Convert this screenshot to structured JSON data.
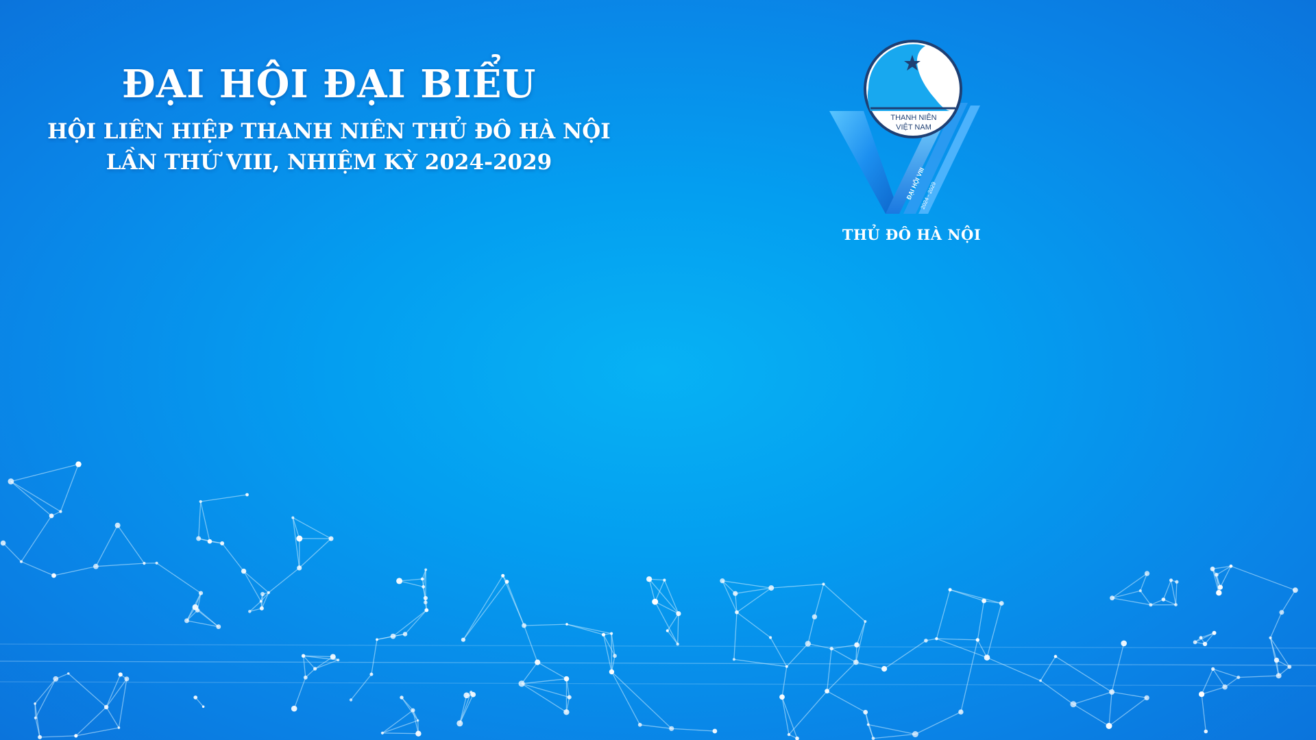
{
  "heading": {
    "title": "ĐẠI HỘI ĐẠI BIỂU",
    "subtitle_line1": "HỘI LIÊN HIỆP THANH NIÊN THỦ ĐÔ HÀ NỘI",
    "subtitle_line2": "LẦN THỨ VIII, NHIỆM KỲ 2024-2029"
  },
  "logo": {
    "emblem_line1": "THANH NIÊN",
    "emblem_line2": "VIỆT NAM",
    "ribbon_text": "ĐẠI HỘI VIII",
    "ribbon_years": "2024 - 2029",
    "caption": "THỦ ĐÔ HÀ NỘI",
    "icon": "star-icon"
  },
  "colors": {
    "background": "#049ef0",
    "text": "#ffffff",
    "emblem_dark": "#1e3f73",
    "emblem_blue": "#18a8ef"
  }
}
